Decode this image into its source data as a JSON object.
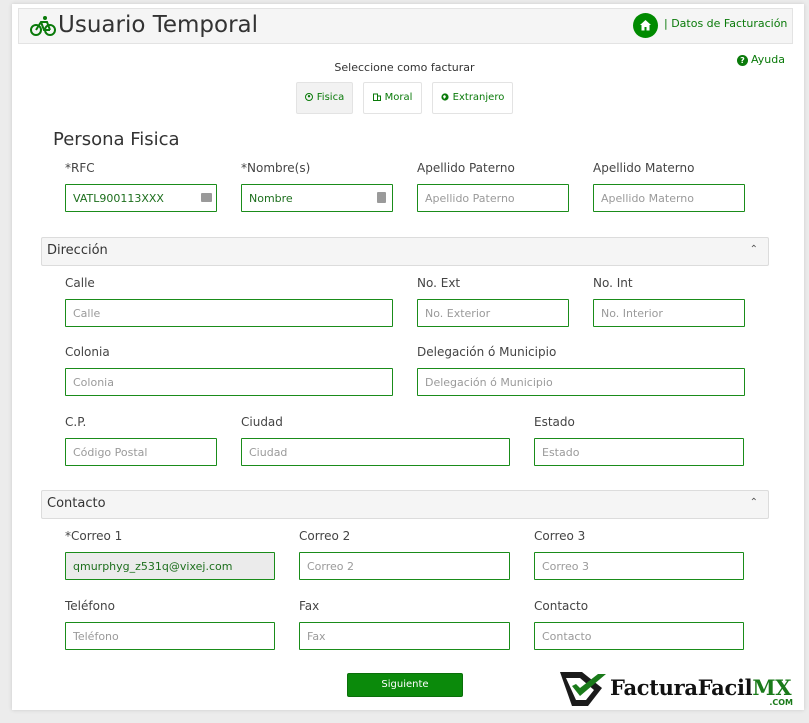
{
  "header": {
    "title": "Usuario Temporal",
    "brand_icon": "bicycle-icon",
    "home_icon": "home-icon",
    "billing_link": "| Datos de Facturación"
  },
  "help": {
    "label": "Ayuda",
    "icon": "question-circle-icon"
  },
  "invoice_type": {
    "prompt": "Seleccione como facturar",
    "options": [
      {
        "label": "Fisica",
        "icon": "person-circle-icon",
        "selected": true
      },
      {
        "label": "Moral",
        "icon": "building-icon",
        "selected": false
      },
      {
        "label": "Extranjero",
        "icon": "globe-icon",
        "selected": false
      }
    ]
  },
  "persona": {
    "title": "Persona Fisica",
    "rfc": {
      "label": "*RFC",
      "value": "VATL900113XXX",
      "icon": "id-card-icon"
    },
    "nombre": {
      "label": "*Nombre(s)",
      "value": "Nombre",
      "icon": "contact-card-icon"
    },
    "apellido_paterno": {
      "label": "Apellido Paterno",
      "placeholder": "Apellido Paterno"
    },
    "apellido_materno": {
      "label": "Apellido Materno",
      "placeholder": "Apellido Materno"
    }
  },
  "direccion": {
    "title": "Dirección",
    "calle": {
      "label": "Calle",
      "placeholder": "Calle"
    },
    "no_ext": {
      "label": "No. Ext",
      "placeholder": "No. Exterior"
    },
    "no_int": {
      "label": "No. Int",
      "placeholder": "No. Interior"
    },
    "colonia": {
      "label": "Colonia",
      "placeholder": "Colonia"
    },
    "municipio": {
      "label": "Delegación ó Municipio",
      "placeholder": "Delegación ó Municipio"
    },
    "cp": {
      "label": "C.P.",
      "placeholder": "Código Postal"
    },
    "ciudad": {
      "label": "Ciudad",
      "placeholder": "Ciudad"
    },
    "estado": {
      "label": "Estado",
      "placeholder": "Estado"
    }
  },
  "contacto": {
    "title": "Contacto",
    "correo1": {
      "label": "*Correo 1",
      "value": "qmurphyg_z531q@vixej.com"
    },
    "correo2": {
      "label": "Correo 2",
      "placeholder": "Correo 2"
    },
    "correo3": {
      "label": "Correo 3",
      "placeholder": "Correo 3"
    },
    "telefono": {
      "label": "Teléfono",
      "placeholder": "Teléfono"
    },
    "fax": {
      "label": "Fax",
      "placeholder": "Fax"
    },
    "contacto": {
      "label": "Contacto",
      "placeholder": "Contacto"
    }
  },
  "submit_label": "Siguiente",
  "logo": {
    "text": "FacturaFacil",
    "mx": "MX",
    "sub": ".COM"
  },
  "colors": {
    "accent": "#008a00",
    "border": "#1a8c1a"
  }
}
